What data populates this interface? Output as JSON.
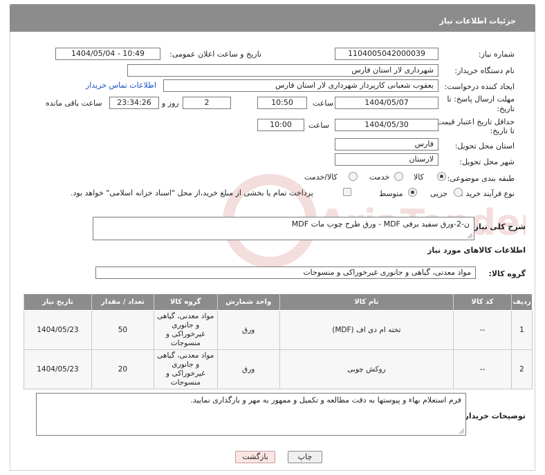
{
  "header": {
    "title": "جزئیات اطلاعات نیاز"
  },
  "fields": {
    "need_number_label": "شماره نیاز:",
    "need_number": "1104005042000039",
    "announce_label": "تاریخ و ساعت اعلان عمومی:",
    "announce_value": "1404/05/04 - 10:49",
    "buyer_org_label": "نام دستگاه خریدار:",
    "buyer_org": "شهرداری لار استان فارس",
    "creator_label": "ایجاد کننده درخواست:",
    "creator": "یعقوب شعبانی کارپرداز شهرداری لار استان فارس",
    "contact_link": "اطلاعات تماس خریدار",
    "reply_deadline_label_1": "مهلت ارسال پاسخ: تا",
    "reply_deadline_label_2": "تاریخ:",
    "reply_date": "1404/05/07",
    "hour_label": "ساعت",
    "reply_time": "10:50",
    "days_value": "2",
    "days_label": "روز و",
    "remaining_time": "23:34:26",
    "remaining_label": "ساعت باقی مانده",
    "price_validity_label_1": "حداقل تاریخ اعتبار قیمت:",
    "price_validity_label_2": "تا تاریخ:",
    "validity_date": "1404/05/30",
    "validity_time": "10:00",
    "province_label": "استان محل تحویل:",
    "province": "فارس",
    "city_label": "شهر محل تحویل:",
    "city": "لارستان",
    "category_label": "طبقه بندی موضوعی:",
    "category_options": [
      "کالا",
      "خدمت",
      "کالا/خدمت"
    ],
    "purchase_type_label": "نوع فرآیند خرید :",
    "purchase_options": [
      "جزیی",
      "متوسط"
    ],
    "payment_note": "پرداخت تمام یا بخشی از مبلغ خرید،از محل \"اسناد خزانه اسلامی\" خواهد بود.",
    "description_label": "شرح کلی نیاز:",
    "description": "ن-2-ورق سفید برفی MDF - ورق طرح چوب مات MDF",
    "goods_info_title": "اطلاعات کالاهای مورد نیاز",
    "goods_group_label": "گروه کالا:",
    "goods_group": "مواد معدنی، گیاهی و جانوری غیرخوراکی و منسوجات",
    "buyer_notes_label": "توضیحات خریدار:",
    "buyer_notes": "فرم استعلام بهاء و پیوستها به دقت مطالعه و تکمیل و ممهور به مهر و بارگذاری نمایید."
  },
  "table": {
    "headers": [
      "ردیف",
      "کد کالا",
      "نام کالا",
      "واحد شمارش",
      "گروه کالا",
      "تعداد / مقدار",
      "تاریخ نیاز"
    ],
    "rows": [
      [
        "1",
        "--",
        "تخته ام دی اف (MDF)",
        "ورق",
        "مواد معدنی، گیاهی و جانوری غیرخوراکی و منسوجات",
        "50",
        "1404/05/23"
      ],
      [
        "2",
        "--",
        "روکش چوبی",
        "ورق",
        "مواد معدنی، گیاهی و جانوری غیرخوراکی و منسوجات",
        "20",
        "1404/05/23"
      ]
    ]
  },
  "buttons": {
    "print": "چاپ",
    "back": "بازگشت"
  },
  "watermark": {
    "text": "AriaTender.net"
  }
}
